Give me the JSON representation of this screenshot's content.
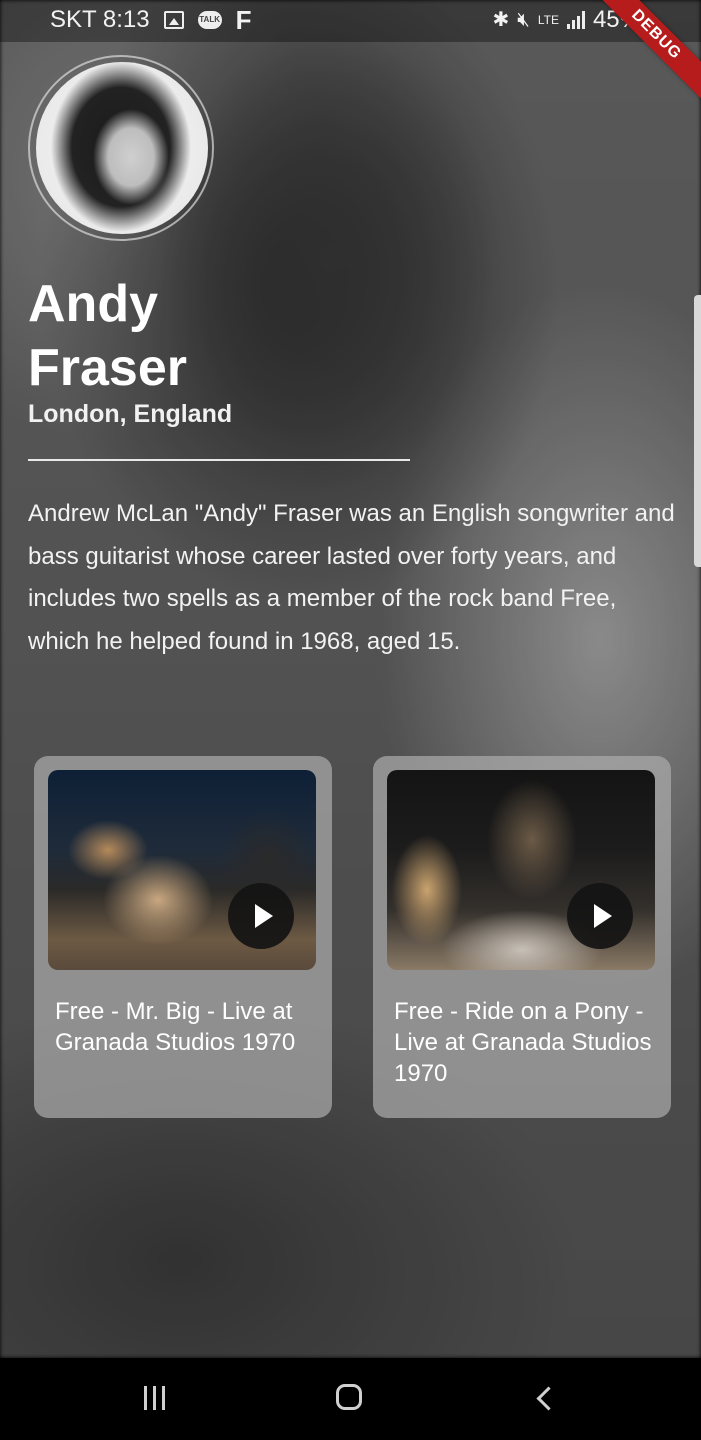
{
  "status_bar": {
    "carrier_time": "SKT 8:13",
    "network": "LTE",
    "battery": "45%",
    "icons": [
      "image-icon",
      "talk-icon",
      "facebook-icon",
      "bluetooth-icon",
      "mute-icon",
      "signal-icon",
      "battery-icon"
    ],
    "debug_label": "DEBUG"
  },
  "artist": {
    "name": "Andy Fraser",
    "location": "London, England",
    "bio": "Andrew McLan \"Andy\" Fraser was an English songwriter and bass guitarist whose career lasted over forty years, and includes two spells as a member of the rock band Free, which he helped found in 1968, aged 15."
  },
  "videos": [
    {
      "title": "Free - Mr. Big - Live at Granada Studios 1970"
    },
    {
      "title": "Free - Ride on a Pony - Live at Granada Studios 1970"
    }
  ],
  "nav": {
    "icons": [
      "recent-apps-icon",
      "home-icon",
      "back-icon"
    ]
  }
}
